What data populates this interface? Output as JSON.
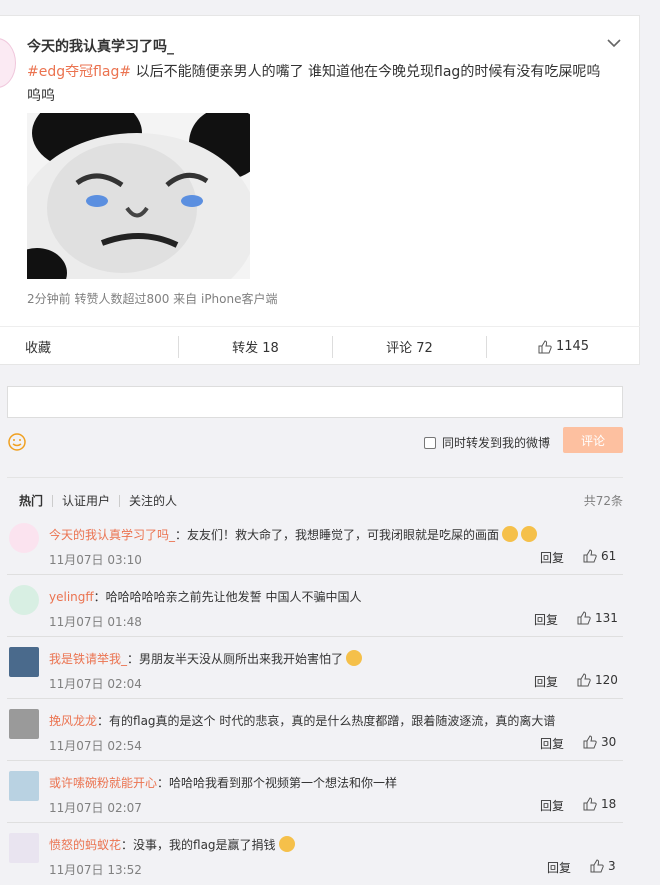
{
  "post": {
    "author": "今天的我认真学习了吗_",
    "tag": "#edg夺冠flag#",
    "text": " 以后不能随便亲男人的嘴了 谁知道他在今晚兑现flag的时候有没有吃屎呢呜呜呜",
    "meta": "2分钟前 转赞人数超过800  来自 iPhone客户端",
    "image_icon": "panda-meme-image"
  },
  "actions": {
    "favorite": "收藏",
    "repost": "转发 18",
    "comment": "评论 72",
    "like": "1145"
  },
  "composer": {
    "repost_label": "同时转发到我的微博",
    "submit": "评论"
  },
  "tabs": {
    "hot": "热门",
    "verified": "认证用户",
    "following": "关注的人",
    "total": "共72条"
  },
  "comments": [
    {
      "user": "今天的我认真学习了吗_",
      "text": "：友友们！救大命了，我想睡觉了，可我闭眼就是吃屎的画面",
      "time": "11月07日 03:10",
      "reply": "回复",
      "likes": "61"
    },
    {
      "user": "yelingff",
      "text": "：哈哈哈哈哈亲之前先让他发誓 中国人不骗中国人",
      "time": "11月07日 01:48",
      "reply": "回复",
      "likes": "131"
    },
    {
      "user": "我是铁请举我_",
      "text": "：男朋友半天没从厕所出来我开始害怕了",
      "time": "11月07日 02:04",
      "reply": "回复",
      "likes": "120"
    },
    {
      "user": "挽风龙龙",
      "text": "：有的flag真的是这个 时代的悲哀，真的是什么热度都蹭，跟着随波逐流，真的离大谱",
      "time": "11月07日 02:54",
      "reply": "回复",
      "likes": "30"
    },
    {
      "user": "或许嗦碗粉就能开心",
      "text": "：哈哈哈我看到那个视频第一个想法和你一样",
      "time": "11月07日 02:07",
      "reply": "回复",
      "likes": "18"
    },
    {
      "user": "愤怒的蚂蚁花",
      "text": "：没事，我的flag是赢了捐钱",
      "time": "11月07日 13:52",
      "reply": "回复",
      "likes": "3"
    }
  ]
}
